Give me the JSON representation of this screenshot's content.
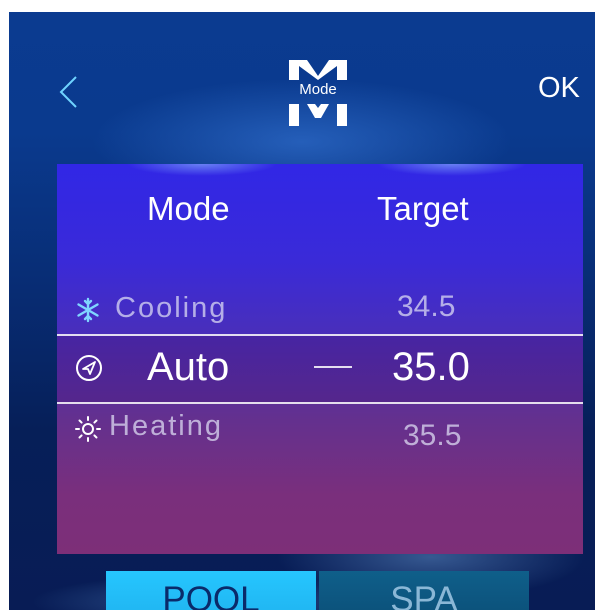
{
  "header": {
    "back_icon": "chevron-left-icon",
    "logo_letter": "M",
    "logo_label": "Mode",
    "ok_label": "OK"
  },
  "panel": {
    "columns": {
      "mode": "Mode",
      "target": "Target"
    },
    "rows": [
      {
        "icon": "snowflake-icon",
        "mode": "Cooling",
        "target": "34.5",
        "selected": false
      },
      {
        "icon": "navigation-icon",
        "mode": "Auto",
        "target": "35.0",
        "selected": true
      },
      {
        "icon": "sun-icon",
        "mode": "Heating",
        "target": "35.5",
        "selected": false
      }
    ]
  },
  "tabs": [
    {
      "label": "POOL",
      "active": true
    },
    {
      "label": "SPA",
      "active": false
    }
  ],
  "colors": {
    "accent_active_tab": "#26c6ff",
    "inactive_tab": "#0b4f78",
    "text_primary": "#ffffff"
  }
}
